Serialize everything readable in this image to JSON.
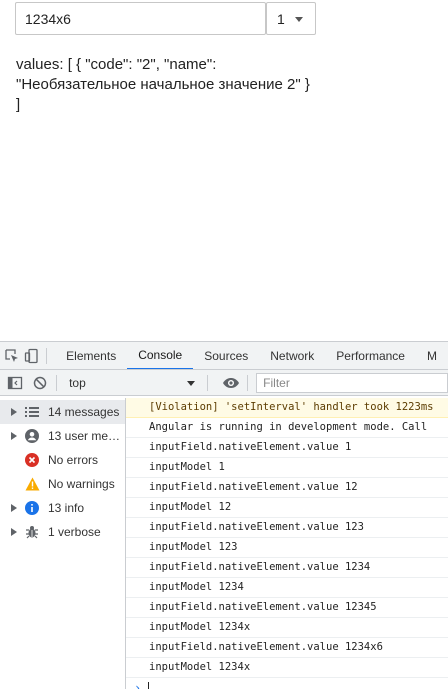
{
  "app": {
    "input_value": "1234x6",
    "select_value": "1",
    "values_text": "values: [ { \"code\": \"2\", \"name\": \"Необязательное начальное значение 2\" } ]"
  },
  "devtools": {
    "tabs": [
      "Elements",
      "Console",
      "Sources",
      "Network",
      "Performance",
      "M"
    ],
    "active_tab": "Console",
    "context": "top",
    "filter_placeholder": "Filter",
    "sidebar": [
      {
        "label": "14 messages",
        "icon": "list-icon"
      },
      {
        "label": "13 user mes…",
        "icon": "user-icon"
      },
      {
        "label": "No errors",
        "icon": "error-icon"
      },
      {
        "label": "No warnings",
        "icon": "warning-icon"
      },
      {
        "label": "13 info",
        "icon": "info-icon"
      },
      {
        "label": "1 verbose",
        "icon": "bug-icon"
      }
    ],
    "console_lines": [
      "[Violation] 'setInterval' handler took 1223ms",
      "Angular is running in development mode. Call",
      "inputField.nativeElement.value 1",
      "inputModel 1",
      "inputField.nativeElement.value 12",
      "inputModel 12",
      "inputField.nativeElement.value 123",
      "inputModel 123",
      "inputField.nativeElement.value 1234",
      "inputModel 1234",
      "inputField.nativeElement.value 12345",
      "inputModel 1234x",
      "inputField.nativeElement.value 1234x6",
      "inputModel 1234x"
    ],
    "colors": {
      "accent": "#1a73e8",
      "error": "#d93025",
      "warning": "#f9ab00",
      "info": "#1a73e8",
      "warn_bg": "#fffbe5"
    }
  }
}
